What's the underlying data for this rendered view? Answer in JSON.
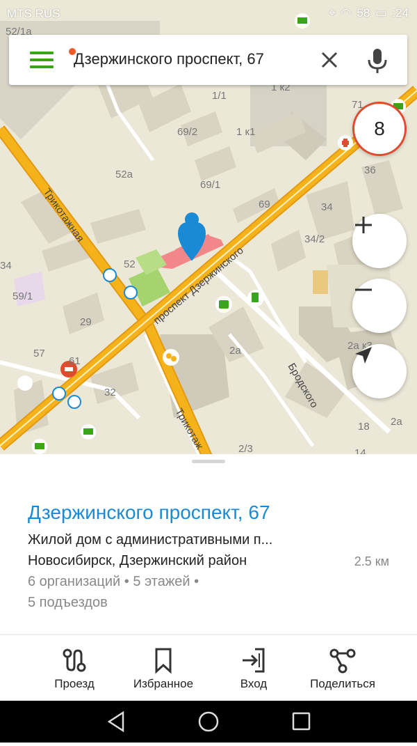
{
  "status_bar": {
    "carrier": "MTS RUS",
    "battery": "58",
    "time": ":24"
  },
  "search": {
    "value": "Дзержинского проспект, 67"
  },
  "map": {
    "badge_count": "8",
    "street_labels": [
      "Трикотажная",
      "проспект Дзержинского",
      "Бродского",
      "Трикотаж"
    ],
    "house_numbers": [
      "52/1а",
      "1/1",
      "1 к2",
      "71",
      "69/2",
      "1 к1",
      "52а",
      "69/1",
      "69",
      "36",
      "34",
      "34/2",
      "52",
      "34",
      "59/1",
      "29",
      "57",
      "61",
      "32",
      "2а",
      "2а к3",
      "18",
      "2а",
      "2/3",
      "14"
    ],
    "colors": {
      "road": "#f5b21a",
      "road_edge": "#e39a10",
      "building": "#d8d3c2",
      "highlight": "#f2878a",
      "park": "#a5d36e",
      "pin": "#1a8ad4"
    }
  },
  "place": {
    "title": "Дзержинского проспект, 67",
    "description": "Жилой дом с административными п...",
    "address": "Новосибирск, Дзержинский район",
    "distance": "2.5 км",
    "meta_line1": "6 организаций • 5 этажей •",
    "meta_line2": "5 подъездов"
  },
  "actions": [
    {
      "label": "Проезд",
      "icon": "route-icon"
    },
    {
      "label": "Избранное",
      "icon": "bookmark-icon"
    },
    {
      "label": "Вход",
      "icon": "entrance-icon"
    },
    {
      "label": "Поделиться",
      "icon": "share-icon"
    }
  ]
}
